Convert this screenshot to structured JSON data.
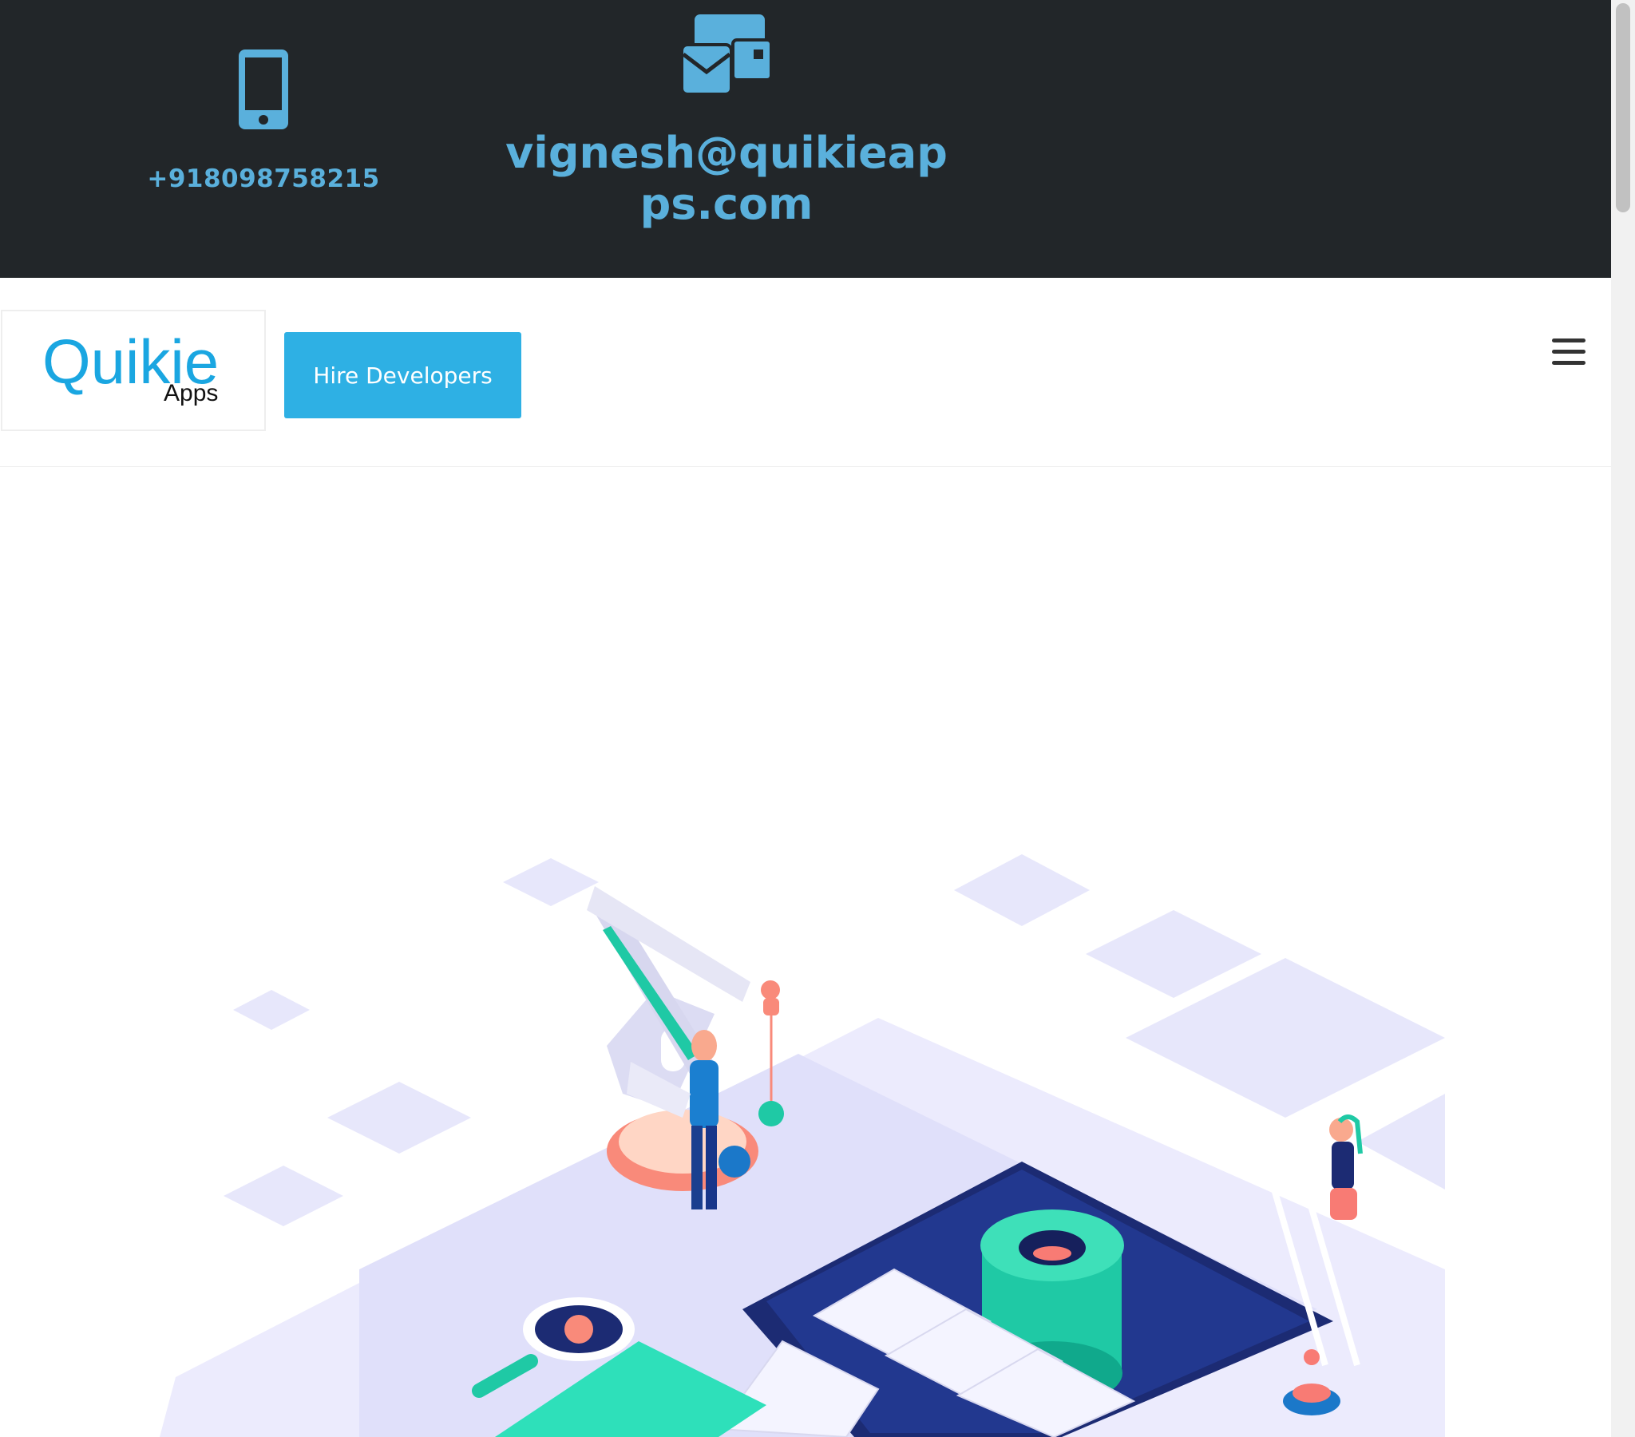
{
  "topbar": {
    "phone": {
      "icon": "mobile-phone-icon",
      "text": "+918098758215"
    },
    "email": {
      "icon": "mail-envelopes-icon",
      "text": "vignesh@quikieapps.com"
    }
  },
  "header": {
    "logo": {
      "main": "Quikie",
      "sub": "Apps"
    },
    "hire_button": "Hire Developers",
    "menu_icon": "hamburger-menu-icon"
  },
  "hero": {
    "illustration": "isometric-app-development-illustration"
  },
  "colors": {
    "topbar_bg": "#222629",
    "accent": "#5ab0dc",
    "button": "#2eb0e4",
    "logo": "#1aa6e1"
  }
}
